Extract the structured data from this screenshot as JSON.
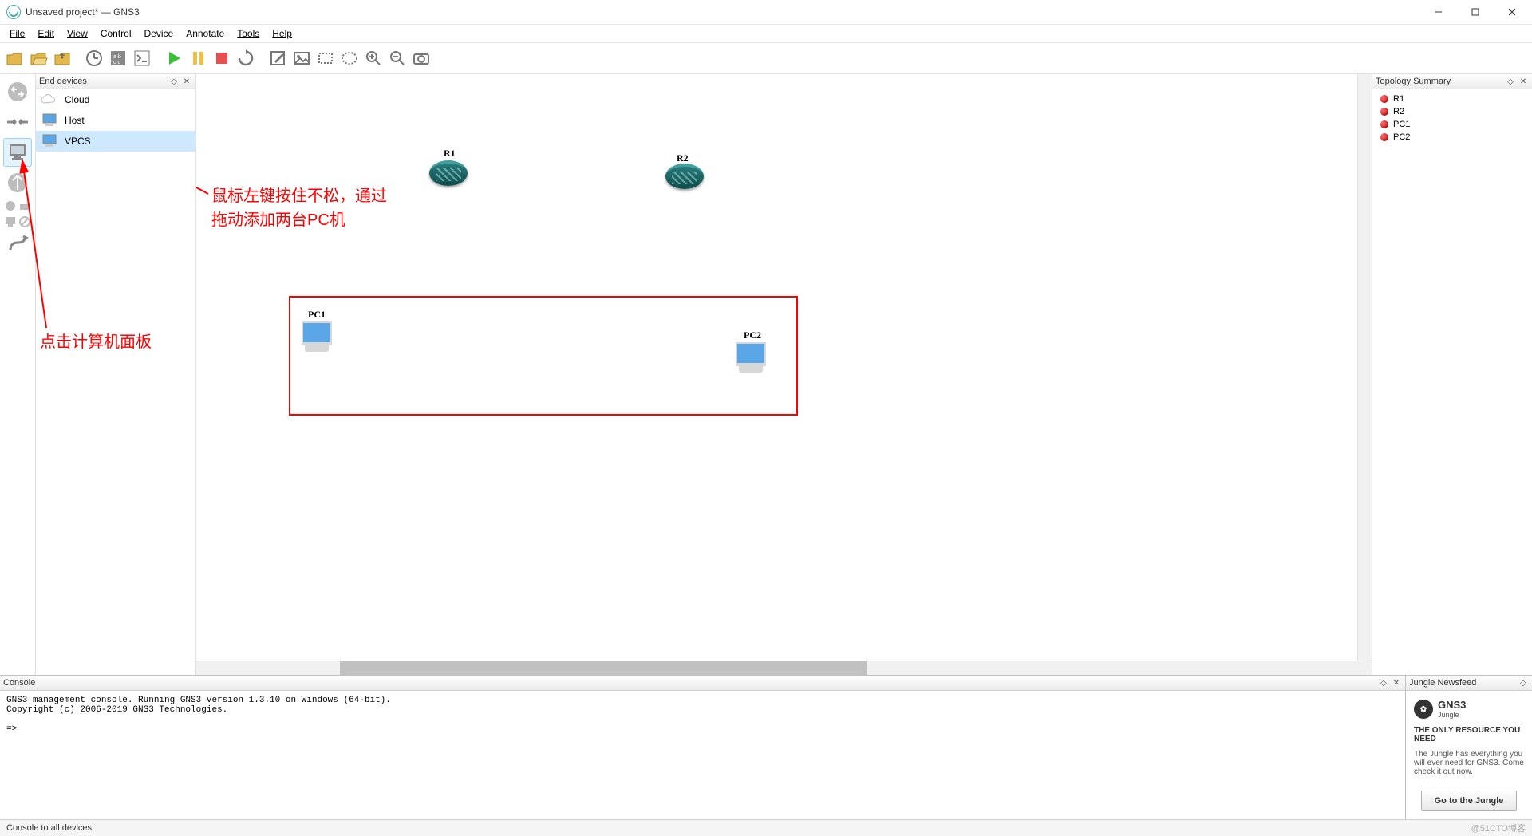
{
  "window": {
    "title": "Unsaved project* — GNS3"
  },
  "menu": {
    "file": "File",
    "edit": "Edit",
    "view": "View",
    "control": "Control",
    "device": "Device",
    "annotate": "Annotate",
    "tools": "Tools",
    "help": "Help"
  },
  "devicePanel": {
    "title": "End devices",
    "items": [
      {
        "label": "Cloud",
        "icon": "cloud",
        "selected": false
      },
      {
        "label": "Host",
        "icon": "host",
        "selected": false
      },
      {
        "label": "VPCS",
        "icon": "vpcs",
        "selected": true
      }
    ]
  },
  "canvas": {
    "nodes": {
      "R1": {
        "label": "R1"
      },
      "R2": {
        "label": "R2"
      },
      "PC1": {
        "label": "PC1"
      },
      "PC2": {
        "label": "PC2"
      }
    },
    "annotations": {
      "a1_line1": "鼠标左键按住不松，通过",
      "a1_line2": "拖动添加两台PC机",
      "a2": "点击计算机面板"
    }
  },
  "topology": {
    "title": "Topology Summary",
    "items": [
      {
        "label": "R1"
      },
      {
        "label": "R2"
      },
      {
        "label": "PC1"
      },
      {
        "label": "PC2"
      }
    ]
  },
  "console": {
    "title": "Console",
    "line1": "GNS3 management console. Running GNS3 version 1.3.10 on Windows (64-bit).",
    "line2": "Copyright (c) 2006-2019 GNS3 Technologies.",
    "prompt": "=>"
  },
  "news": {
    "title": "Jungle Newsfeed",
    "brand": "GNS3",
    "brand_sub": "Jungle",
    "headline": "THE ONLY RESOURCE YOU NEED",
    "body": "The Jungle has everything you will ever need for GNS3. Come check it out now.",
    "button": "Go to the Jungle"
  },
  "status": {
    "text": "Console to all devices",
    "watermark": "@51CTO博客"
  }
}
